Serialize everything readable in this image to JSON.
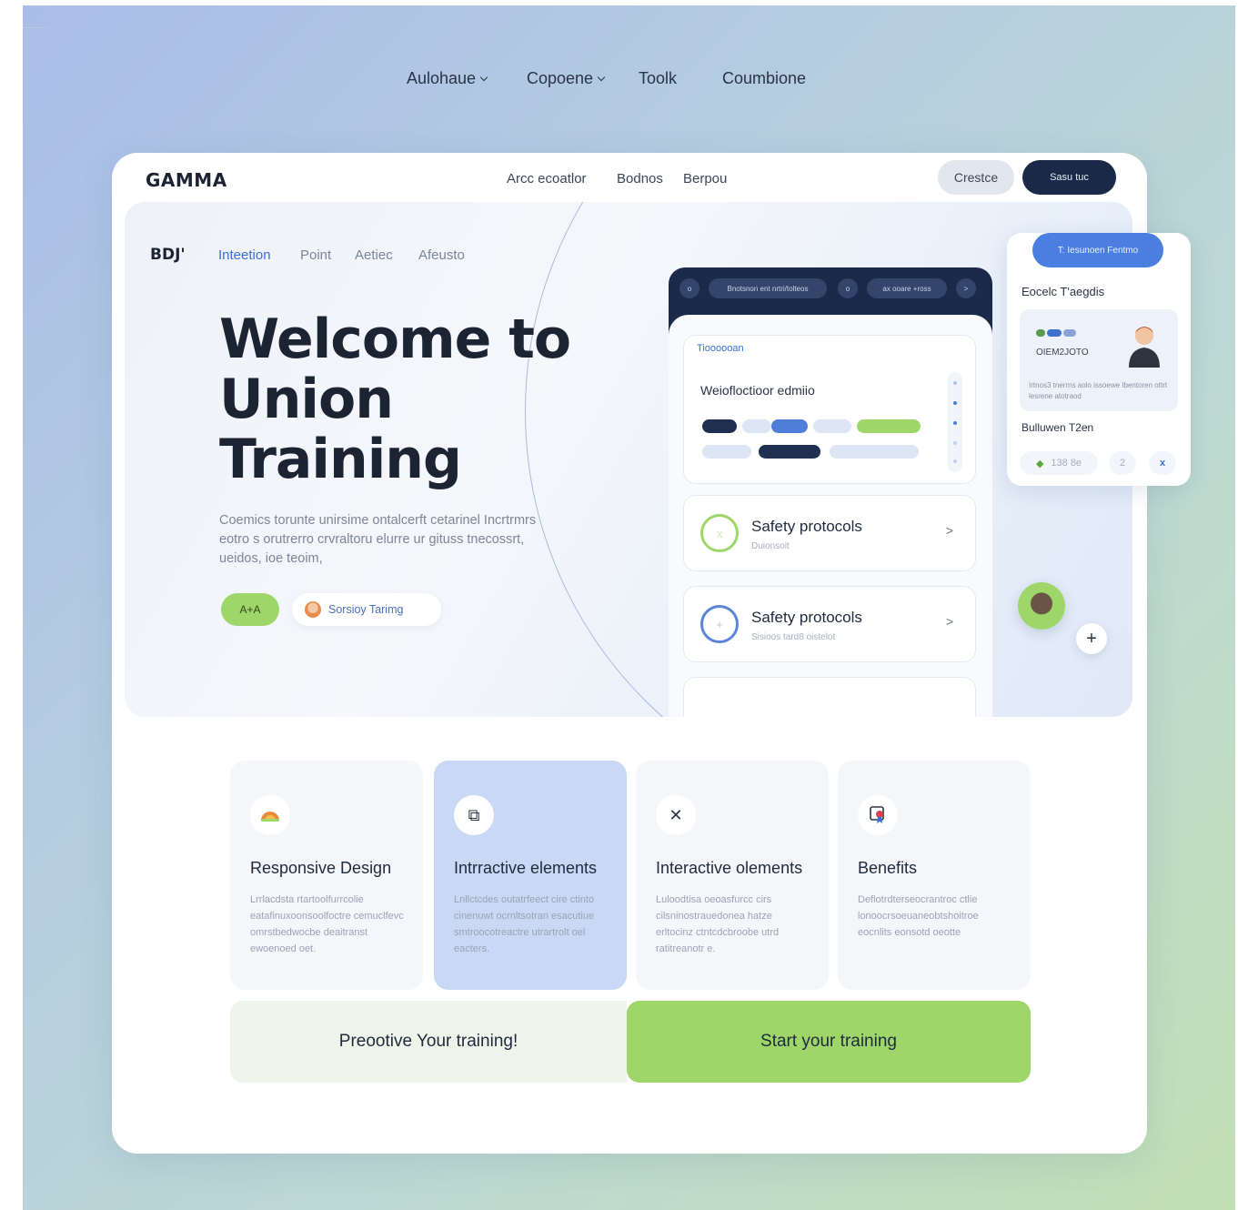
{
  "top_nav": {
    "items": [
      "Aulohaue",
      "Copoene",
      "Toolk",
      "Coumbione"
    ]
  },
  "header": {
    "brand": "GAMMA",
    "nav": [
      "Arcc ecoatlor",
      "Bodnos",
      "Berpou"
    ],
    "create_label": "Crestce",
    "primary_label": "Sasu tuc"
  },
  "hero": {
    "logo": "BDJ'",
    "tabs": [
      "Inteetion",
      "Point",
      "Aetiec",
      "Afeusto"
    ],
    "title": "Welcome to Union Training",
    "description": "Coemics torunte unirsime ontalcerft cetarinel Incrtrmrs eotro s orutrerro crvraltoru elurre ur gituss tnecossrt, ueidos, ioe teoim,",
    "green_button": "A+A",
    "pill_button": "Sorsioy Tarimg"
  },
  "phone": {
    "top_bar": [
      "o",
      "Bnotsnon ent nrtri/tolteos",
      "o",
      "ax ooare +ross",
      ">"
    ],
    "card_label": "Tioooooan",
    "card_title": "Weiofloctioor edmiio",
    "rows": [
      {
        "title": "Safety protocols",
        "subtitle": "Duionsoit",
        "arrow": ">"
      },
      {
        "title": "Safety protocols",
        "subtitle": "Sisioos tard8 oistelot",
        "arrow": ">"
      }
    ]
  },
  "side_panel": {
    "button": "T: Iesunoen Fentmo",
    "heading": "Eocelc T'aegdis",
    "name": "OIEM2JOTO",
    "text": "Irtnos3 tnerrns aolo issoewe Ibentoren ottrt lesrene atotraod",
    "team": "Bulluwen T2en",
    "chips": [
      "138 8e",
      "2",
      "x"
    ]
  },
  "float_plus": "+",
  "features": [
    {
      "title": "Responsive Design",
      "text": "Lrrlacdsta rtartoolfurrcolie eatafinuxoonsoolfoctre cemuclfevc omrstbedwocbe deaitranst ewoenoed oet.",
      "icon": "rainbow-icon"
    },
    {
      "title": "Intrractive elements",
      "text": "Lnllctcdes outatrfeect cire ctinto cinenuwt ocrnltsotran esacutiue smtroocotreactre utrartrolt oel eacters.",
      "icon": "shapes-icon"
    },
    {
      "title": "Interactive olements",
      "text": "Luloodtisa oeoasfurcc cirs cilsninostrauedonea hatze erltocinz ctntcdcbroobe utrd ratitreanotr e.",
      "icon": "tools-icon"
    },
    {
      "title": "Benefits",
      "text": "Deflotrdterseocrantroc ctlie lonoocrsoeuaneobtshoitroe eocnlits eonsotd oeotte",
      "icon": "award-icon"
    }
  ],
  "cta": {
    "secondary": "Preootive Your training!",
    "primary": "Start your training"
  }
}
